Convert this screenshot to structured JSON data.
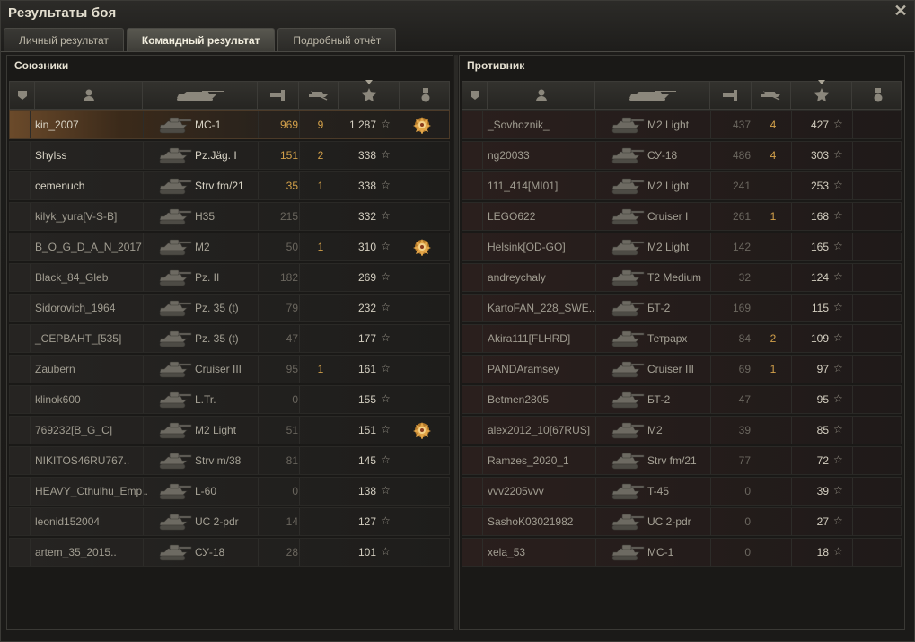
{
  "window": {
    "title": "Результаты боя"
  },
  "tabs": [
    {
      "label": "Личный результат",
      "active": false
    },
    {
      "label": "Командный результат",
      "active": true
    },
    {
      "label": "Подробный отчёт",
      "active": false
    }
  ],
  "allies": {
    "title": "Союзники",
    "rows": [
      {
        "name": "kin_2007",
        "tank": "МС-1",
        "damage": "969",
        "kills": "9",
        "xp": "1 287",
        "medal": true,
        "mine": true,
        "strong": true
      },
      {
        "name": "Shylss",
        "tank": "Pz.Jäg. I",
        "damage": "151",
        "kills": "2",
        "xp": "338",
        "medal": false,
        "strong": true
      },
      {
        "name": "cemenuch",
        "tank": "Strv fm/21",
        "damage": "35",
        "kills": "1",
        "xp": "338",
        "medal": false,
        "strong": true
      },
      {
        "name": "kilyk_yura[V-S-B]",
        "tank": "H35",
        "damage": "215",
        "kills": "",
        "xp": "332",
        "medal": false
      },
      {
        "name": "B_O_G_D_A_N_2017",
        "tank": "M2",
        "damage": "50",
        "kills": "1",
        "xp": "310",
        "medal": true
      },
      {
        "name": "Black_84_Gleb",
        "tank": "Pz. II",
        "damage": "182",
        "kills": "",
        "xp": "269",
        "medal": false
      },
      {
        "name": "Sidorovich_1964",
        "tank": "Pz. 35 (t)",
        "damage": "79",
        "kills": "",
        "xp": "232",
        "medal": false
      },
      {
        "name": "_СЕРВАНТ_[535]",
        "tank": "Pz. 35 (t)",
        "damage": "47",
        "kills": "",
        "xp": "177",
        "medal": false
      },
      {
        "name": "Zaubern",
        "tank": "Cruiser III",
        "damage": "95",
        "kills": "1",
        "xp": "161",
        "medal": false
      },
      {
        "name": "klinok600",
        "tank": "L.Tr.",
        "damage": "0",
        "kills": "",
        "xp": "155",
        "medal": false
      },
      {
        "name": "769232[B_G_C]",
        "tank": "M2 Light",
        "damage": "51",
        "kills": "",
        "xp": "151",
        "medal": true
      },
      {
        "name": "NIKITOS46RU767..",
        "tank": "Strv m/38",
        "damage": "81",
        "kills": "",
        "xp": "145",
        "medal": false
      },
      {
        "name": "HEAVY_Cthulhu_Emp..",
        "tank": "L-60",
        "damage": "0",
        "kills": "",
        "xp": "138",
        "medal": false
      },
      {
        "name": "leonid152004",
        "tank": "UC 2-pdr",
        "damage": "14",
        "kills": "",
        "xp": "127",
        "medal": false
      },
      {
        "name": "artem_35_2015..",
        "tank": "СУ-18",
        "damage": "28",
        "kills": "",
        "xp": "101",
        "medal": false
      }
    ]
  },
  "enemies": {
    "title": "Противник",
    "rows": [
      {
        "name": "_Sovhoznik_",
        "tank": "M2 Light",
        "damage": "437",
        "kills": "4",
        "xp": "427"
      },
      {
        "name": "ng20033",
        "tank": "СУ-18",
        "damage": "486",
        "kills": "4",
        "xp": "303"
      },
      {
        "name": "111_414[MI01]",
        "tank": "M2 Light",
        "damage": "241",
        "kills": "",
        "xp": "253"
      },
      {
        "name": "LEGO622",
        "tank": "Cruiser I",
        "damage": "261",
        "kills": "1",
        "xp": "168"
      },
      {
        "name": "Helsink[OD-GO]",
        "tank": "M2 Light",
        "damage": "142",
        "kills": "",
        "xp": "165"
      },
      {
        "name": "andreychaly",
        "tank": "T2 Medium",
        "damage": "32",
        "kills": "",
        "xp": "124"
      },
      {
        "name": "KartoFAN_228_SWE..",
        "tank": "БТ-2",
        "damage": "169",
        "kills": "",
        "xp": "115"
      },
      {
        "name": "Akira111[FLHRD]",
        "tank": "Тетрарх",
        "damage": "84",
        "kills": "2",
        "xp": "109"
      },
      {
        "name": "PANDAramsey",
        "tank": "Cruiser III",
        "damage": "69",
        "kills": "1",
        "xp": "97"
      },
      {
        "name": "Betmen2805",
        "tank": "БТ-2",
        "damage": "47",
        "kills": "",
        "xp": "95"
      },
      {
        "name": "alex2012_10[67RUS]",
        "tank": "M2",
        "damage": "39",
        "kills": "",
        "xp": "85"
      },
      {
        "name": "Ramzes_2020_1",
        "tank": "Strv fm/21",
        "damage": "77",
        "kills": "",
        "xp": "72"
      },
      {
        "name": "vvv2205vvv",
        "tank": "T-45",
        "damage": "0",
        "kills": "",
        "xp": "39"
      },
      {
        "name": "SashoK03021982",
        "tank": "UC 2-pdr",
        "damage": "0",
        "kills": "",
        "xp": "27"
      },
      {
        "name": "xela_53",
        "tank": "МС-1",
        "damage": "0",
        "kills": "",
        "xp": "18"
      }
    ]
  },
  "icons": {
    "close": "close-icon",
    "platoon": "platoon-icon",
    "player": "player-icon",
    "vehicle": "vehicle-icon",
    "damage": "damage-icon",
    "kills": "kills-icon",
    "xp": "xp-star-icon",
    "medal": "medal-icon"
  },
  "colors": {
    "accent": "#d2a04a",
    "text": "#d9d4c6",
    "muted": "#a19d91"
  }
}
